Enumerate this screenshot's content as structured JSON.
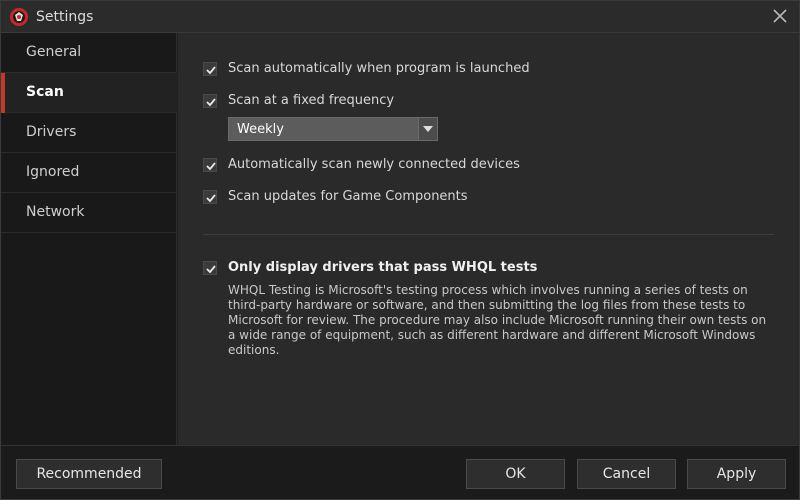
{
  "window": {
    "title": "Settings"
  },
  "sidebar": {
    "items": [
      {
        "label": "General",
        "active": false
      },
      {
        "label": "Scan",
        "active": true
      },
      {
        "label": "Drivers",
        "active": false
      },
      {
        "label": "Ignored",
        "active": false
      },
      {
        "label": "Network",
        "active": false
      }
    ]
  },
  "scan": {
    "auto_on_launch": {
      "label": "Scan automatically when program is launched",
      "checked": true
    },
    "fixed_frequency": {
      "label": "Scan at a fixed frequency",
      "checked": true
    },
    "frequency_select": {
      "value": "Weekly"
    },
    "new_devices": {
      "label": "Automatically scan newly connected devices",
      "checked": true
    },
    "game_components": {
      "label": "Scan updates for Game Components",
      "checked": true
    },
    "whql": {
      "label": "Only display drivers that pass WHQL tests",
      "checked": true,
      "description": "WHQL Testing is Microsoft's testing process which involves running a series of tests on third-party hardware or software, and then submitting the log files from these tests to Microsoft for review. The procedure may also include Microsoft running their own tests on a wide range of equipment, such as different hardware and different Microsoft Windows editions."
    }
  },
  "footer": {
    "recommended_label": "Recommended",
    "ok_label": "OK",
    "cancel_label": "Cancel",
    "apply_label": "Apply"
  },
  "colors": {
    "accent": "#c0392b",
    "background": "#2a2a2a",
    "sidebar": "#191919"
  }
}
